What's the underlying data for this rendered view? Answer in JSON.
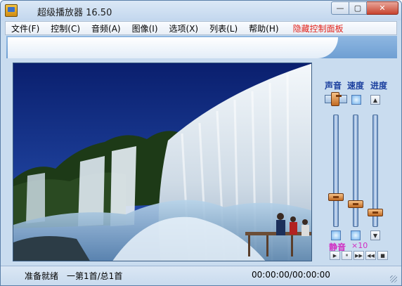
{
  "window": {
    "title": "超级播放器 16.50"
  },
  "window_buttons": {
    "minimize": "—",
    "maximize": "▢",
    "close": "✕"
  },
  "menu": [
    {
      "label": "文件(F)"
    },
    {
      "label": "控制(C)"
    },
    {
      "label": "音频(A)"
    },
    {
      "label": "图像(I)"
    },
    {
      "label": "选项(X)"
    },
    {
      "label": "列表(L)"
    },
    {
      "label": "帮助(H)"
    }
  ],
  "menu_extra": {
    "label": "隐藏控制面板",
    "color": "#e2231a"
  },
  "controls": {
    "volume_label": "声音",
    "speed_label": "速度",
    "progress_label": "进度",
    "mute_label": "静音",
    "speed_value": "×10",
    "volume_level": 0.25,
    "speed_level": 0.18,
    "progress_level": 0.1
  },
  "transport": {
    "play": "▶",
    "pause": "⏸",
    "forward": "▶▶",
    "rewind": "◀◀",
    "stop": "■"
  },
  "status": {
    "state": "准备就绪",
    "track": "一第1首/总1首",
    "time": "00:00:00/00:00:00"
  },
  "icons": {
    "app": "player-icon",
    "progress_up": "arrow-up-icon",
    "progress_down": "arrow-down-icon"
  },
  "colors": {
    "accent_label": "#1b3f9e",
    "mute": "#d02cc2",
    "window_bg": "#c9dcef"
  }
}
